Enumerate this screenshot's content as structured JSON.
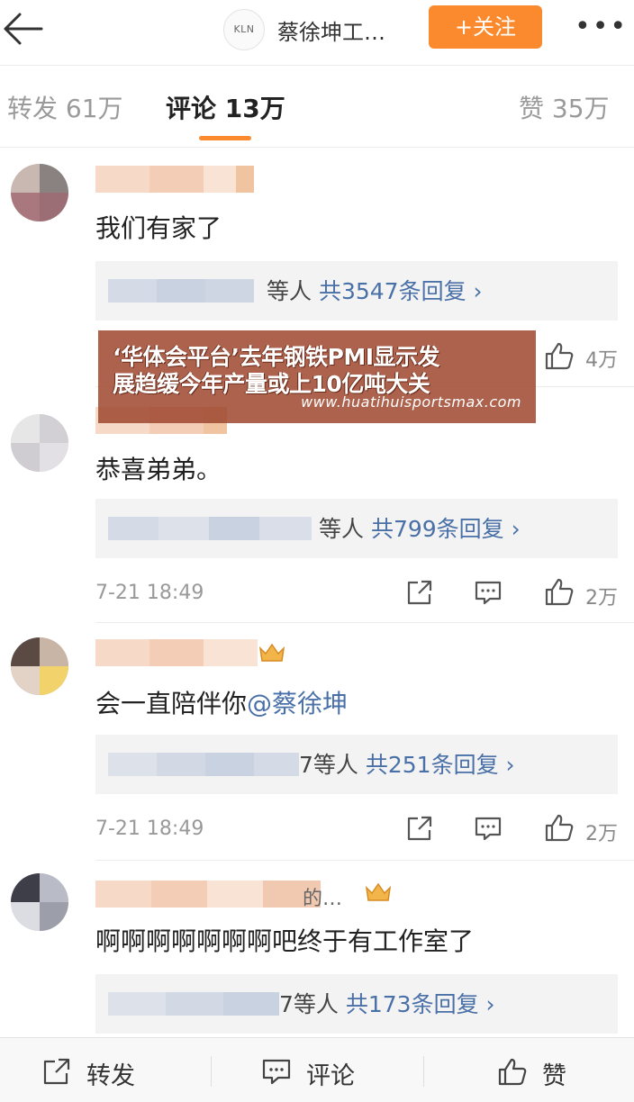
{
  "header": {
    "profile_logo_text": "KLN",
    "profile_name": "蔡徐坤工…",
    "follow_label": "+关注",
    "more_label": "•••"
  },
  "tabs": {
    "repost": "转发 61万",
    "comment": "评论 13万",
    "like": "赞 35万"
  },
  "comments": [
    {
      "text": "我们有家了",
      "reply_suffix": "等人",
      "reply_count": "共3547条回复 ›",
      "like_count": "4万"
    },
    {
      "text": "恭喜弟弟。",
      "reply_suffix": "等人",
      "reply_count": "共799条回复 ›",
      "timestamp": "7-21 18:49",
      "like_count": "2万"
    },
    {
      "text_prefix": "会一直陪伴你",
      "mention": "@蔡徐坤",
      "reply_suffix": "7等人",
      "reply_count": "共251条回复 ›",
      "timestamp": "7-21 18:49",
      "like_count": "2万"
    },
    {
      "text": "啊啊啊啊啊啊啊吧终于有工作室了",
      "name_ellipsis": "的…",
      "reply_suffix": "7等人",
      "reply_count": "共173条回复 ›"
    }
  ],
  "watermark": {
    "line1": "‘华体会平台’去年钢铁PMI显示发",
    "line2": "展趋缓今年产量或上10亿吨大关",
    "url": "www.huatihuisportsmax.com"
  },
  "bottom_bar": {
    "repost": "转发",
    "comment": "评论",
    "like": "赞"
  },
  "colors": {
    "accent": "#fb8a2e",
    "link": "#4a70a8",
    "watermark_bg": "#9e4830"
  }
}
